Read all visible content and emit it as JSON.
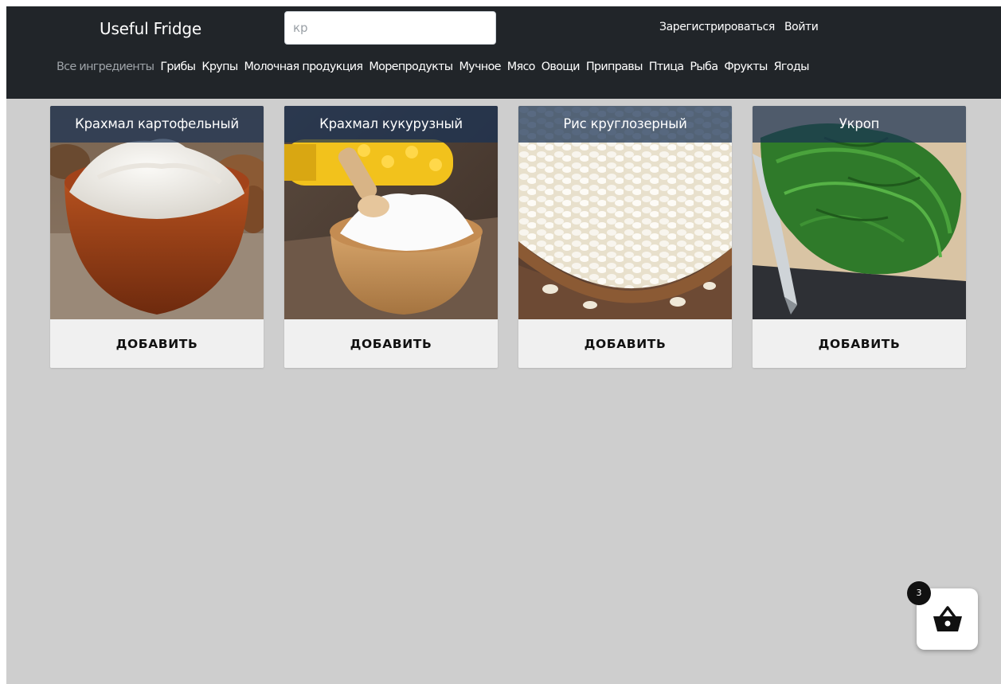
{
  "header": {
    "brand": "Useful Fridge",
    "search": {
      "value": "кр"
    },
    "auth": {
      "register": "Зарегистрироваться",
      "login": "Войти"
    },
    "categories": [
      "Все ингредиенты",
      "Грибы",
      "Крупы",
      "Молочная продукция",
      "Морепродукты",
      "Мучное",
      "Мясо",
      "Овощи",
      "Приправы",
      "Птица",
      "Рыба",
      "Фрукты",
      "Ягоды"
    ]
  },
  "products": [
    {
      "title": "Крахмал картофельный",
      "button": "ДОБАВИТЬ",
      "image": "potato-starch-bowl"
    },
    {
      "title": "Крахмал кукурузный",
      "button": "ДОБАВИТЬ",
      "image": "corn-starch-bowl"
    },
    {
      "title": "Рис круглозерный",
      "button": "ДОБАВИТЬ",
      "image": "round-rice-spoon"
    },
    {
      "title": "Укроп",
      "button": "ДОБАВИТЬ",
      "image": "dill-bunch"
    }
  ],
  "basket": {
    "count": "3",
    "icon": "basket-icon"
  },
  "colors": {
    "header_bg": "#212529",
    "page_bg": "#cecece",
    "title_overlay": "#193255",
    "card_footer": "#f0f0f0"
  }
}
